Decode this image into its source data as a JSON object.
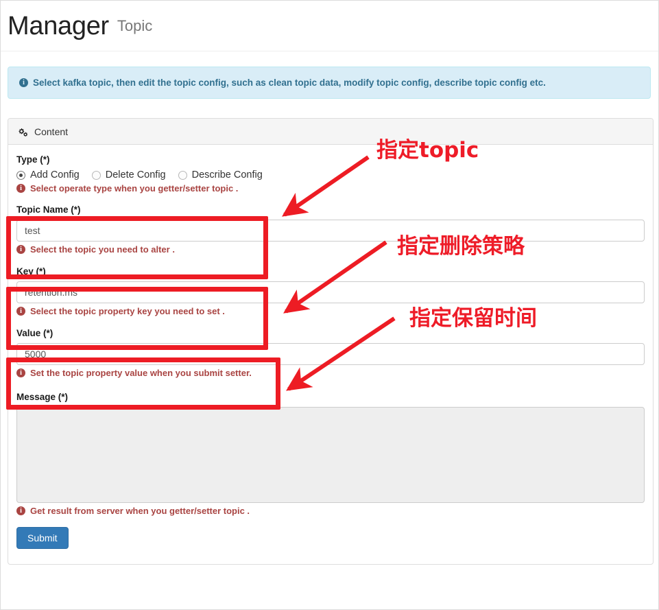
{
  "header": {
    "title": "Manager",
    "subtitle": "Topic"
  },
  "alert": {
    "icon": "info-circle-icon",
    "text": "Select kafka topic, then edit the topic config, such as clean topic data, modify topic config, describe topic config etc."
  },
  "panel": {
    "icon": "cogs-icon",
    "heading": "Content"
  },
  "form": {
    "type": {
      "label": "Type (*)",
      "options": [
        {
          "label": "Add Config",
          "selected": true
        },
        {
          "label": "Delete Config",
          "selected": false
        },
        {
          "label": "Describe Config",
          "selected": false
        }
      ],
      "help": "Select operate type when you getter/setter topic ."
    },
    "topic_name": {
      "label": "Topic Name (*)",
      "value": "test",
      "placeholder": "",
      "help": "Select the topic you need to alter ."
    },
    "key": {
      "label": "Key (*)",
      "value": "retention.ms",
      "placeholder": "",
      "help": "Select the topic property key you need to set ."
    },
    "value": {
      "label": "Value (*)",
      "value": "5000",
      "placeholder": "",
      "help": "Set the topic property value when you submit setter."
    },
    "message": {
      "label": "Message (*)",
      "value": "",
      "placeholder": "",
      "help": "Get result from server when you getter/setter topic ."
    },
    "submit": "Submit"
  },
  "annotations": [
    {
      "text": "指定topic"
    },
    {
      "text": "指定删除策略"
    },
    {
      "text": "指定保留时间"
    }
  ],
  "colors": {
    "accent_red": "#ed1c24",
    "primary_blue": "#337ab7",
    "info_bg": "#d9edf7",
    "info_text": "#31708f",
    "help_text": "#a94442"
  }
}
